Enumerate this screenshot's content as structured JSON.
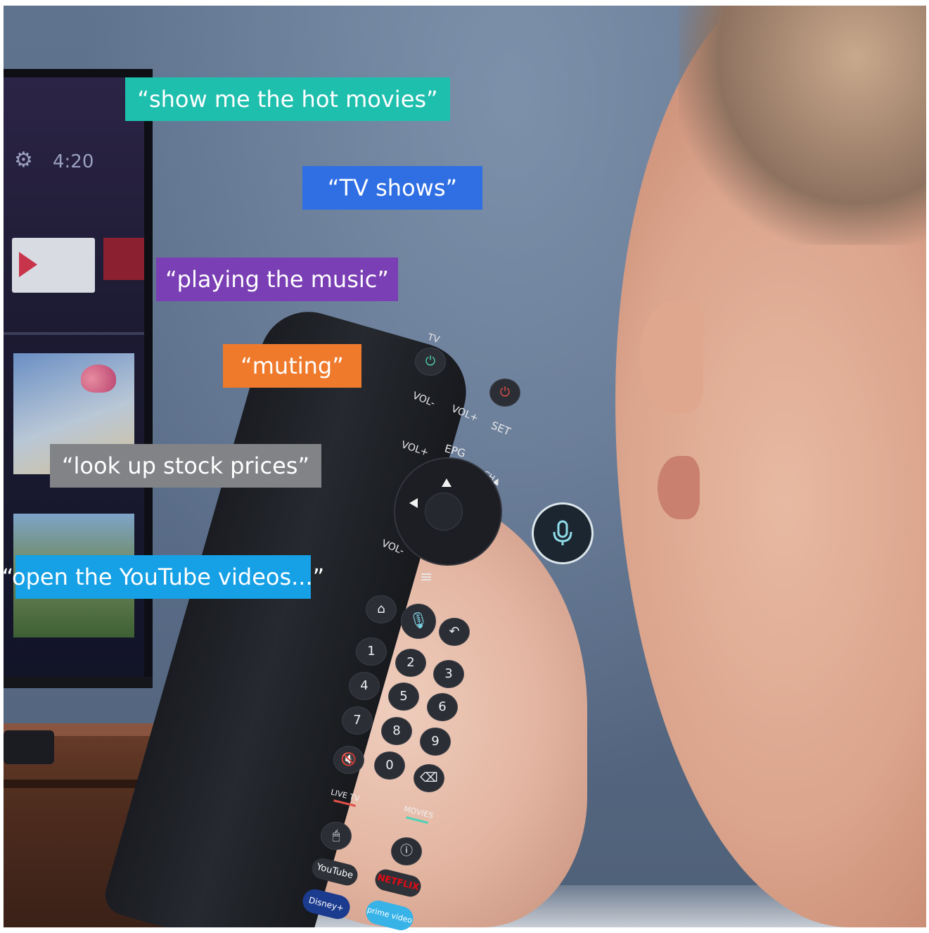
{
  "scene": {
    "tv_clock": "4:20"
  },
  "speech_bubbles": [
    {
      "text": "“show me the hot movies”",
      "color": "#1fbfae"
    },
    {
      "text": "“TV shows”",
      "color": "#2f6fe3"
    },
    {
      "text": "“playing the music”",
      "color": "#7a3fb4"
    },
    {
      "text": "“muting”",
      "color": "#ef7a2c"
    },
    {
      "text": "“look up stock prices”",
      "color": "#828387"
    },
    {
      "text": "“open the YouTube videos...”",
      "color": "#16a0e5"
    }
  ],
  "remote": {
    "tv_label": "TV",
    "vol_minus": "VOL-",
    "vol_plus": "VOL+",
    "set": "SET",
    "vol_plus_2": "VOL+",
    "epg": "EPG",
    "ch": "CH▲",
    "vol_minus_2": "VOL-",
    "digits": [
      "1",
      "2",
      "3",
      "4",
      "5",
      "6",
      "7",
      "8",
      "9",
      "0"
    ],
    "live_tv": "LIVE TV",
    "movies": "MOVIES",
    "apps": {
      "youtube": "YouTube",
      "netflix": "NETFLIX",
      "disney": "Disney+",
      "prime": "prime video"
    }
  }
}
